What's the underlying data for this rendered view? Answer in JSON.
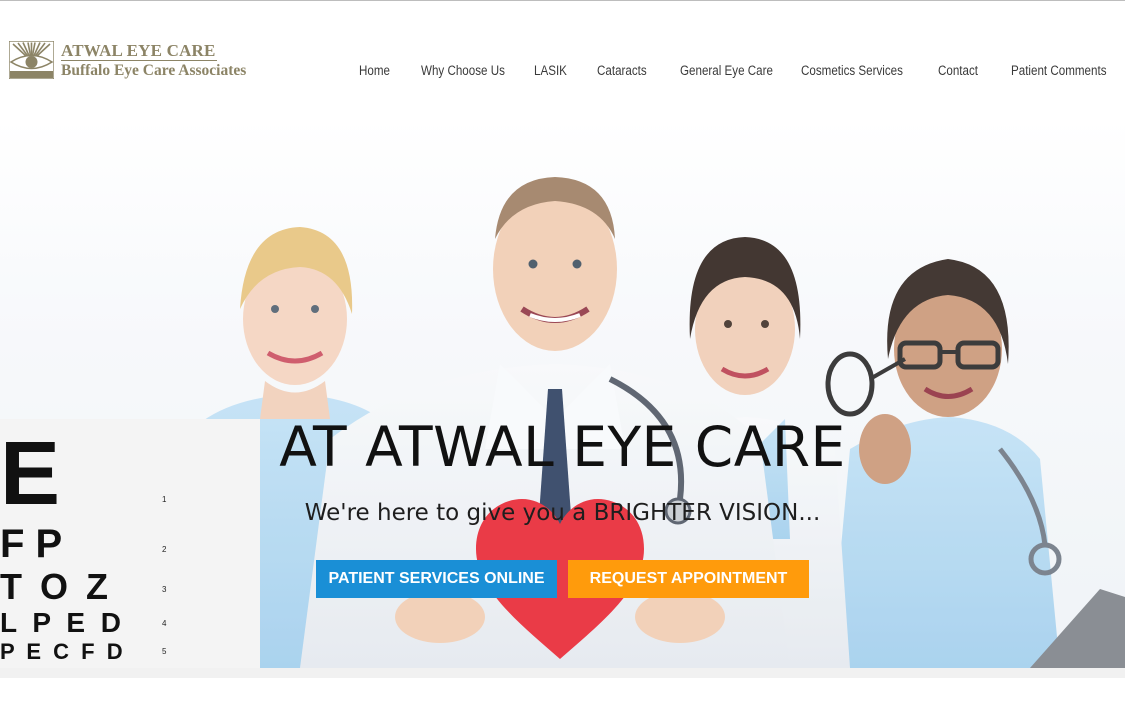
{
  "logo": {
    "line1": "ATWAL EYE CARE",
    "line2": "Buffalo Eye Care Associates",
    "color": "#8c8466"
  },
  "nav": {
    "items": [
      {
        "label": "Home"
      },
      {
        "label": "Why Choose Us"
      },
      {
        "label": "LASIK"
      },
      {
        "label": "Cataracts"
      },
      {
        "label": "General Eye Care"
      },
      {
        "label": "Cosmetics Services"
      },
      {
        "label": "Contact"
      },
      {
        "label": "Patient Comments"
      }
    ]
  },
  "hero": {
    "title": "AT ATWAL EYE CARE",
    "subtitle": "We're here to give you a BRIGHTER VISION...",
    "buttons": {
      "patient_services": "PATIENT SERVICES ONLINE",
      "request_appointment": "REQUEST APPOINTMENT"
    },
    "colors": {
      "blue": "#1a8fd6",
      "orange": "#ff9b0c",
      "heart": "#e8202e"
    },
    "eye_chart": {
      "rows": [
        "E",
        "F  P",
        "T O Z",
        "L P E D",
        "P E C F D"
      ],
      "numbers": [
        "1",
        "2",
        "3",
        "4",
        "5"
      ]
    }
  }
}
